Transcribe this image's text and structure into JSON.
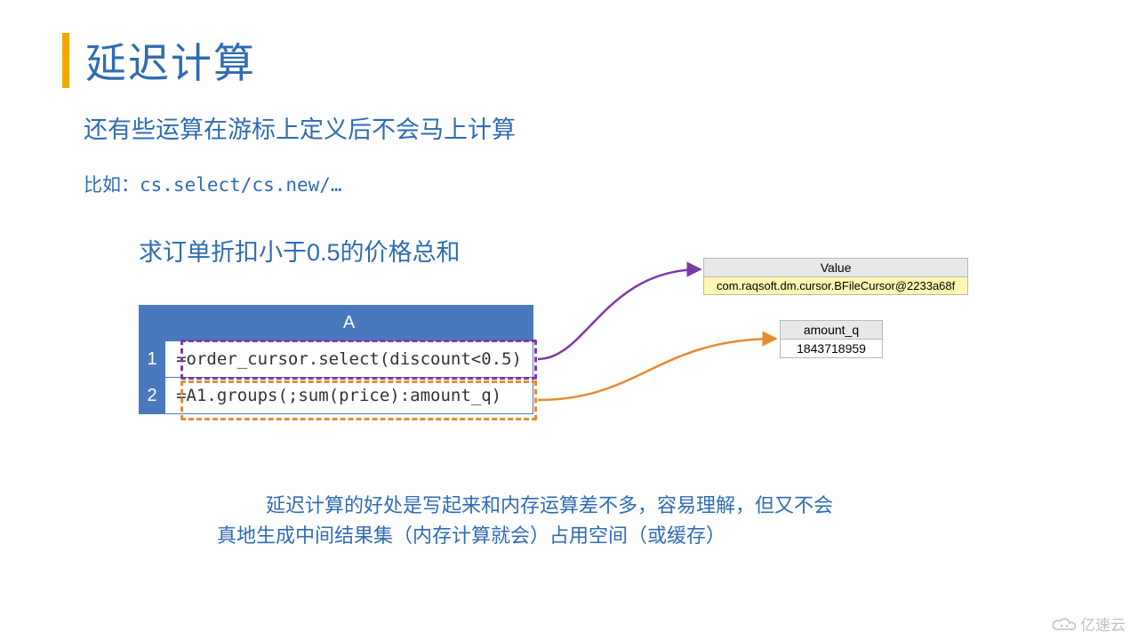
{
  "title": "延迟计算",
  "subtitle": "还有些运算在游标上定义后不会马上计算",
  "example_prefix": "比如：",
  "example_code": "cs.select/cs.new/…",
  "sub2": "求订单折扣小于0.5的价格总和",
  "table": {
    "headerA": "A",
    "rows": [
      {
        "n": "1",
        "code": "=order_cursor.select(discount<0.5)"
      },
      {
        "n": "2",
        "code": "=A1.groups(;sum(price):amount_q)"
      }
    ]
  },
  "result1": {
    "header": "Value",
    "value": "com.raqsoft.dm.cursor.BFileCursor@2233a68f"
  },
  "result2": {
    "header": "amount_q",
    "value": "1843718959"
  },
  "footer_line1": "延迟计算的好处是写起来和内存运算差不多，容易理解，但又不会",
  "footer_line2": "真地生成中间结果集（内存计算就会）占用空间（或缓存）",
  "watermark": "亿速云"
}
